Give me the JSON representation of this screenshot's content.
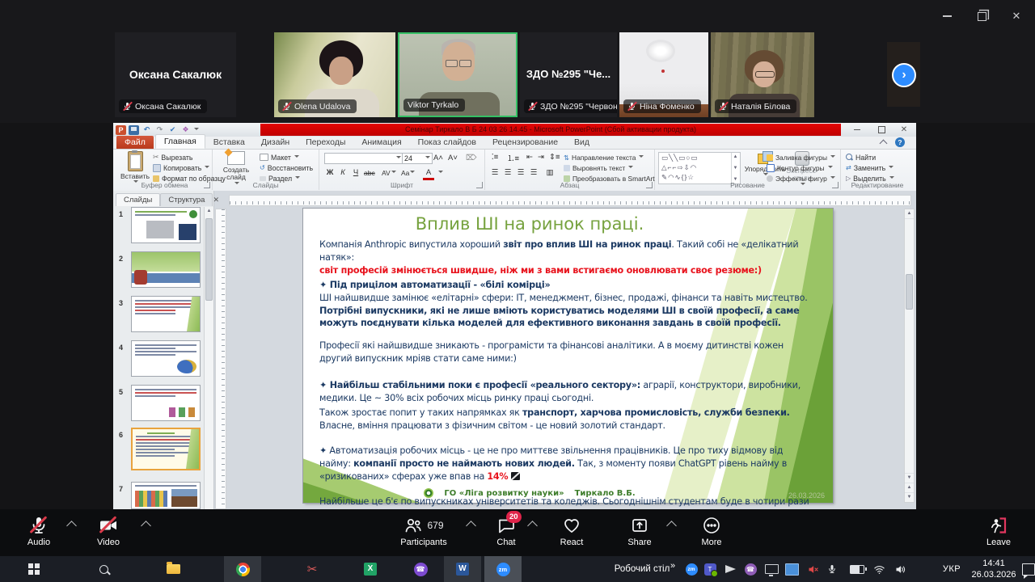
{
  "gallery": {
    "tiles": [
      {
        "center_name": "Оксана Сакалюк",
        "label": "Оксана Сакалюк"
      },
      {
        "label": "Olena Udalova"
      },
      {
        "label": "Viktor Tyrkalo"
      },
      {
        "center_name": "ЗДО №295 \"Че...",
        "label": "ЗДО №295 \"Червон..."
      },
      {
        "label": "Ніна Фоменко"
      },
      {
        "label": "Наталія Білова"
      }
    ]
  },
  "window": {
    "close_glyph": "✕"
  },
  "powerpoint": {
    "title": "Семінар Тиркало В Б 24 03 26 14.45 - Microsoft PowerPoint (Сбой активации продукта)",
    "close_glyph": "✕",
    "tabs": [
      "Файл",
      "Главная",
      "Вставка",
      "Дизайн",
      "Переходы",
      "Анимация",
      "Показ слайдов",
      "Рецензирование",
      "Вид"
    ],
    "help_glyph": "?",
    "ribbon": {
      "clipboard": {
        "paste": "Вставить",
        "cut": "Вырезать",
        "copy": "Копировать",
        "format_painter": "Формат по образцу",
        "group": "Буфер обмена"
      },
      "slides": {
        "new_slide": "Создать слайд",
        "layout": "Макет",
        "reset": "Восстановить",
        "section": "Раздел",
        "group": "Слайды"
      },
      "font": {
        "size": "24",
        "bold": "Ж",
        "italic": "К",
        "underline": "Ч",
        "strikethrough": "abc",
        "spacing": "AV",
        "case": "Aa",
        "color": "A",
        "group": "Шрифт"
      },
      "paragraph": {
        "text_direction": "Направление текста",
        "align_text": "Выровнять текст",
        "smartart": "Преобразовать в SmartArt",
        "group": "Абзац"
      },
      "drawing": {
        "arrange": "Упорядочить",
        "quick_styles": "Экспресс-стили",
        "shape_fill": "Заливка фигуры",
        "shape_outline": "Контур фигуры",
        "shape_effects": "Эффекты фигур",
        "group": "Рисование",
        "shapes_row1": "▭╲╲▭○▭",
        "shapes_row2": "△⌐⌐⇨⇩◠",
        "shapes_row3": "✎◠∿{}☆"
      },
      "editing": {
        "find": "Найти",
        "replace": "Заменить",
        "select": "Выделить",
        "group": "Редактирование"
      }
    },
    "slide_panel": {
      "tab_slides": "Слайды",
      "tab_outline": "Структура",
      "close_glyph": "✕",
      "numbers": [
        "1",
        "2",
        "3",
        "4",
        "5",
        "6",
        "7"
      ]
    },
    "slide": {
      "title": "Вплив ШІ на ринок праці.",
      "paragraphs": [
        {
          "runs": [
            {
              "t": "Компанія Anthropic випустила хороший ",
              "s": "n"
            },
            {
              "t": "звіт про вплив ШІ на ринок праці",
              "s": "b"
            },
            {
              "t": ". Такий собі не «делікатний натяк»:",
              "s": "n"
            }
          ]
        },
        {
          "runs": [
            {
              "t": "світ професій змінюється швидше, ніж ми з вами встигаємо оновлювати своє резюме:)",
              "s": "r"
            }
          ]
        },
        {
          "runs": [
            {
              "t": "✦ Під прицілом автоматизації - «білі комірці»",
              "s": "b"
            }
          ]
        },
        {
          "runs": [
            {
              "t": "ШІ найшвидше замінює «елітарні» сфери: ІТ, менеджмент, бізнес, продажі, фінанси та навіть мистецтво. ",
              "s": "n"
            },
            {
              "t": "Потрібні випускники, які не лише вміють користуватись моделями ШІ в своїй професії, а саме можуть поєднувати кілька моделей для ефективного виконання завдань в своїй професії.",
              "s": "b"
            }
          ]
        },
        {
          "runs": [
            {
              "t": "Професії які найшвидше зникають - програмісти та фінансові аналітики. А в моєму дитинстві кожен другий випускник мріяв стати саме ними:)",
              "s": "n"
            }
          ]
        },
        {
          "runs": [
            {
              "t": "✦ Найбільш стабільними поки є професії «реального сектору»:",
              "s": "b"
            },
            {
              "t": " аграрії, конструктори, виробники, медики. Це ~ 30% всіх робочих місць ринку праці сьогодні.",
              "s": "n"
            }
          ]
        },
        {
          "runs": [
            {
              "t": "Також зростає попит у таких напрямках як ",
              "s": "n"
            },
            {
              "t": "транспорт, харчова промисловість, служби безпеки.",
              "s": "b"
            },
            {
              "t": "\nВласне, вміння працювати з фізичним світом - це новий золотий стандарт.",
              "s": "n"
            }
          ]
        },
        {
          "runs": [
            {
              "t": "✦ Автоматизація робочих місць - це не про миттєве звільнення працівників. Це про тиху відмову від найму: ",
              "s": "n"
            },
            {
              "t": "компанії просто не наймають нових людей.",
              "s": "b"
            },
            {
              "t": " Так, з моменту появи ChatGPT рівень найму в «ризикованих» сферах уже впав на ",
              "s": "n"
            },
            {
              "t": "14%",
              "s": "rb"
            },
            {
              "t": " ",
              "s": "n"
            }
          ],
          "icon": "chart-decreasing"
        },
        {
          "runs": [
            {
              "t": "Найбільше це б'є по випускниках університетів та коледжів. Сьогоднішнім студентам буде в чотири рази складніше знайти роботу після випуску.",
              "s": "n"
            }
          ]
        }
      ],
      "footer_org": "ГО «Ліга розвитку науки»",
      "footer_author": "Тиркало В.Б.",
      "footer_date": "26.03.2026"
    }
  },
  "zoom_toolbar": {
    "audio": "Audio",
    "video": "Video",
    "participants": "Participants",
    "participants_count": "679",
    "chat": "Chat",
    "chat_badge": "20",
    "react": "React",
    "share": "Share",
    "more": "More",
    "leave": "Leave"
  },
  "taskbar": {
    "desktop_label": "Робочий стіл",
    "tray_expand": "»",
    "language": "УКР",
    "time": "14:41",
    "date": "26.03.2026"
  },
  "colors": {
    "accent_blue": "#2D8CFF",
    "active_speaker_green": "#35C065",
    "muted_red": "#D93A4A",
    "titlebar_red": "#D40000",
    "slide_green": "#76A23E",
    "body_navy": "#1C3A63",
    "alert_red": "#E8131D",
    "badge_red": "#E0244A"
  }
}
